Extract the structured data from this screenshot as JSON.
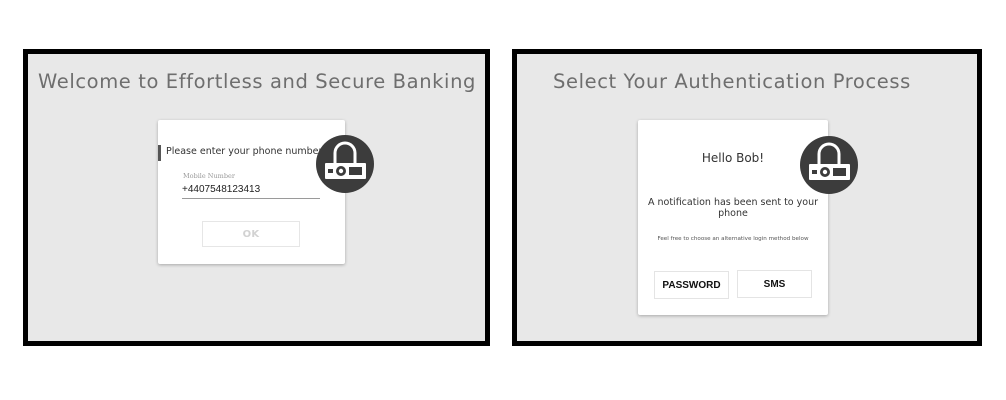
{
  "left_screen": {
    "title": "Welcome to Effortless and Secure Banking",
    "prompt": "Please enter your phone number",
    "field_label": "Mobile Number",
    "phone_value": "+4407548123413",
    "ok_label": "OK",
    "badge_icon": "lock-icon"
  },
  "right_screen": {
    "title": "Select Your Authentication Process",
    "greeting": "Hello Bob!",
    "notification": "A notification has been sent to your phone",
    "alternative_text": "Feel free to choose an alternative login method below",
    "password_label": "PASSWORD",
    "sms_label": "SMS",
    "badge_icon": "lock-icon"
  },
  "colors": {
    "panel_bg": "#e8e8e8",
    "frame": "#000000",
    "badge": "#3c3c3c",
    "title_text": "#6e6e6e"
  }
}
